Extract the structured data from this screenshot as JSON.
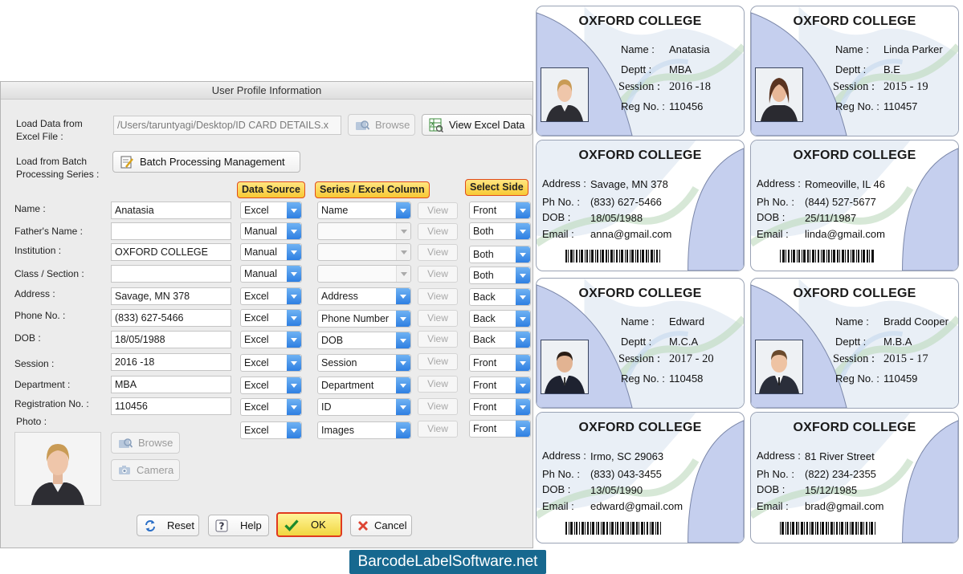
{
  "dialog": {
    "title": "User Profile Information",
    "load_excel_label_1": "Load Data from",
    "load_excel_label_2": "Excel File :",
    "excel_path": "/Users/taruntyagi/Desktop/ID CARD DETAILS.x",
    "browse_label": "Browse",
    "view_excel_label": "View Excel Data",
    "batch_label_1": "Load from Batch",
    "batch_label_2": "Processing Series :",
    "batch_button_label": "Batch Processing Management",
    "col_data_source": "Data Source",
    "col_series": "Series / Excel Column",
    "col_side": "Select Side",
    "view_label": "View",
    "photo_label": "Photo :",
    "photo_browse_label": "Browse",
    "camera_label": "Camera",
    "reset_label": "Reset",
    "help_label": "Help",
    "ok_label": "OK",
    "cancel_label": "Cancel",
    "rows": [
      {
        "label": "Name :",
        "value": "Anatasia",
        "source": "Excel",
        "series": "Name",
        "side": "Front"
      },
      {
        "label": "Father's Name :",
        "value": "",
        "source": "Manual",
        "series": "",
        "side": "Both"
      },
      {
        "label": "Institution :",
        "value": "OXFORD COLLEGE",
        "source": "Manual",
        "series": "",
        "side": "Both"
      },
      {
        "label": "Class / Section :",
        "value": "",
        "source": "Manual",
        "series": "",
        "side": "Both"
      },
      {
        "label": "Address :",
        "value": "Savage, MN 378",
        "source": "Excel",
        "series": "Address",
        "side": "Back"
      },
      {
        "label": "Phone No. :",
        "value": "(833) 627-5466",
        "source": "Excel",
        "series": "Phone Number",
        "side": "Back"
      },
      {
        "label": "DOB :",
        "value": "18/05/1988",
        "source": "Excel",
        "series": "DOB",
        "side": "Back"
      },
      {
        "label": "Session :",
        "value": "2016 -18",
        "source": "Excel",
        "series": "Session",
        "side": "Front"
      },
      {
        "label": "Department :",
        "value": "MBA",
        "source": "Excel",
        "series": "Department",
        "side": "Front"
      },
      {
        "label": "Registration No. :",
        "value": "110456",
        "source": "Excel",
        "series": "ID",
        "side": "Front"
      },
      {
        "label": "",
        "value": "",
        "source": "Excel",
        "series": "Images",
        "side": "Front"
      }
    ]
  },
  "cards": {
    "college": "OXFORD COLLEGE",
    "front_labels": {
      "name": "Name :",
      "dept": "Deptt :",
      "session": "Session :",
      "reg": "Reg No. :"
    },
    "back_labels": {
      "address": "Address :",
      "phone": "Ph No. :",
      "dob": "DOB :",
      "email": "Email :"
    },
    "fronts": [
      {
        "name": "Anatasia",
        "dept": "MBA",
        "session": "2016 -18",
        "reg": "110456"
      },
      {
        "name": "Linda Parker",
        "dept": "B.E",
        "session": "2015 - 19",
        "reg": "110457"
      },
      {
        "name": "Edward",
        "dept": "M.C.A",
        "session": "2017 - 20",
        "reg": "110458"
      },
      {
        "name": "Bradd Cooper",
        "dept": "M.B.A",
        "session": "2015 - 17",
        "reg": "110459"
      }
    ],
    "backs": [
      {
        "address": "Savage, MN 378",
        "phone": "(833) 627-5466",
        "dob": "18/05/1988",
        "email": "anna@gmail.com"
      },
      {
        "address": "Romeoville, IL 46",
        "phone": "(844) 527-5677",
        "dob": "25/11/1987",
        "email": "linda@gmail.com"
      },
      {
        "address": "Irmo, SC 29063",
        "phone": "(833) 043-3455",
        "dob": "13/05/1990",
        "email": "edward@gmail.com"
      },
      {
        "address": "81 River Street",
        "phone": "(822) 234-2355",
        "dob": "15/12/1985",
        "email": "brad@gmail.com"
      }
    ]
  },
  "brand": "BarcodeLabelSoftware.net",
  "colors": {
    "accent_blue": "#2e7fe2",
    "highlight_yellow": "#f8c934",
    "highlight_border": "#e04c1c",
    "brand_bg": "#17688f"
  }
}
